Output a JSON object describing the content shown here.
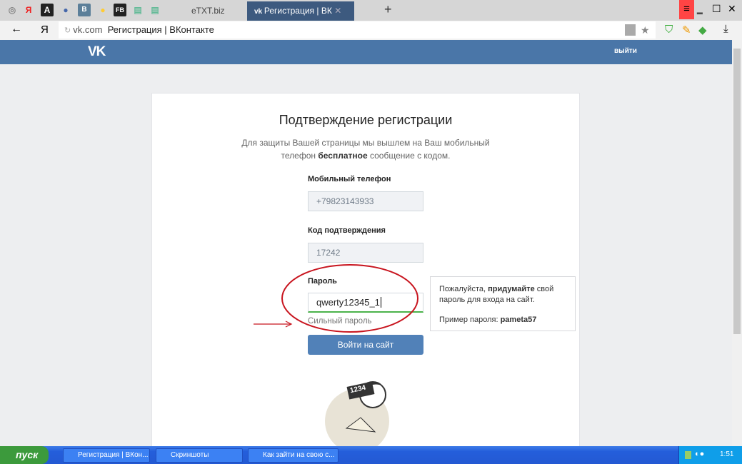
{
  "browser": {
    "pinned_tabs": [
      "Я",
      "A",
      "B",
      "FB"
    ],
    "tabs": [
      {
        "label": "eTXT.biz"
      },
      {
        "label": "Регистрация | ВКонтакте",
        "active": true
      }
    ],
    "new_tab": "+",
    "url_domain": "vk.com",
    "url_title": "Регистрация | ВКонтакте",
    "yandex_button": "Я"
  },
  "vk": {
    "logo": "VK",
    "logout": "выйти"
  },
  "form": {
    "title": "Подтверждение регистрации",
    "desc_line1": "Для защиты Вашей страницы мы вышлем на Ваш мобильный",
    "desc_line2_pre": "телефон ",
    "desc_line2_bold": "бесплатное",
    "desc_line2_post": " сообщение с кодом.",
    "phone_label": "Мобильный телефон",
    "phone_value": "+79823143933",
    "code_label": "Код подтверждения",
    "code_value": "17242",
    "password_label": "Пароль",
    "password_value": "qwerty12345_1",
    "strength": "Сильный пароль",
    "submit": "Войти на сайт",
    "illustration_text": "1234"
  },
  "tooltip": {
    "pre": "Пожалуйста, ",
    "bold": "придумайте",
    "post": " свой пароль для входа на сайт.",
    "example_label": "Пример пароля: ",
    "example": "pameta57"
  },
  "taskbar": {
    "start": "пуск",
    "items": [
      "Регистрация | ВКон...",
      "Скриншоты",
      "Как зайти на свою с..."
    ],
    "clock": "1:51"
  },
  "colors": {
    "vk_blue": "#4a76a8",
    "strength_green": "#4bb34b",
    "annotation_red": "#c8141e"
  }
}
